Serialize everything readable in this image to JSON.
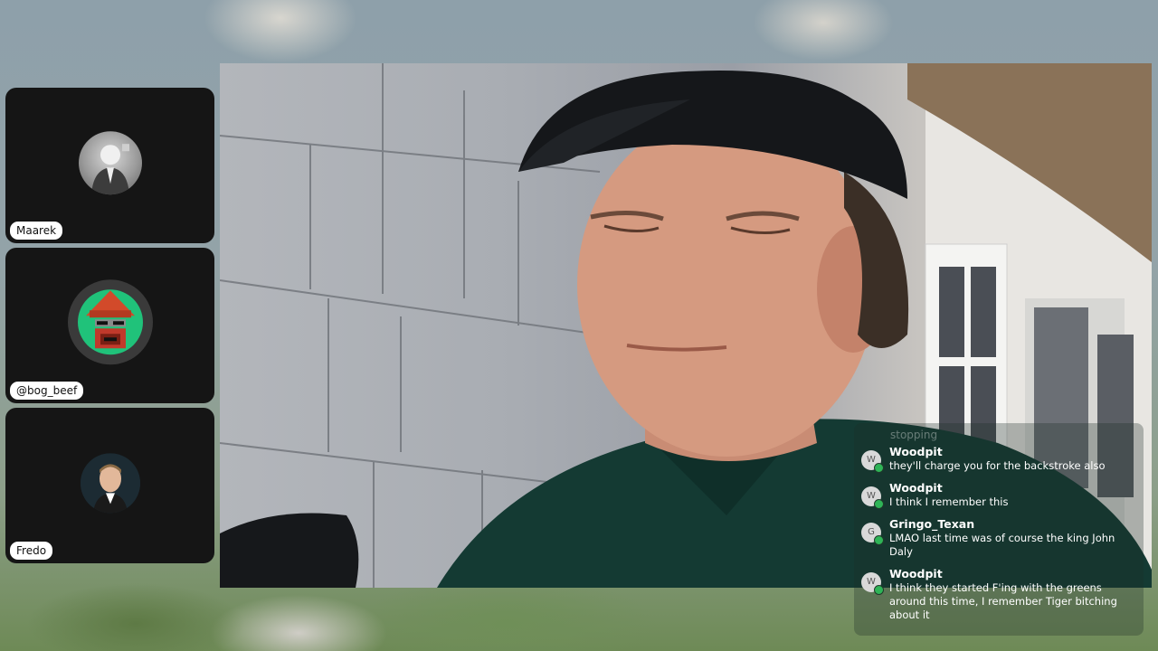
{
  "participants": [
    {
      "name": "Maarek"
    },
    {
      "name": "@bog_beef"
    },
    {
      "name": "Fredo"
    }
  ],
  "chat": {
    "faded_text": "stopping",
    "messages": [
      {
        "initial": "W",
        "user": "Woodpit",
        "text": "they'll charge you for the backstroke also"
      },
      {
        "initial": "W",
        "user": "Woodpit",
        "text": "I think I remember this"
      },
      {
        "initial": "G",
        "user": "Gringo_Texan",
        "text": "LMAO last time was of course the king John Daly"
      },
      {
        "initial": "W",
        "user": "Woodpit",
        "text": "I think they started F'ing with the greens around this time, I remember Tiger bitching about it"
      }
    ]
  },
  "colors": {
    "tile_bg": "#151515",
    "badge_green": "#2fb457"
  }
}
